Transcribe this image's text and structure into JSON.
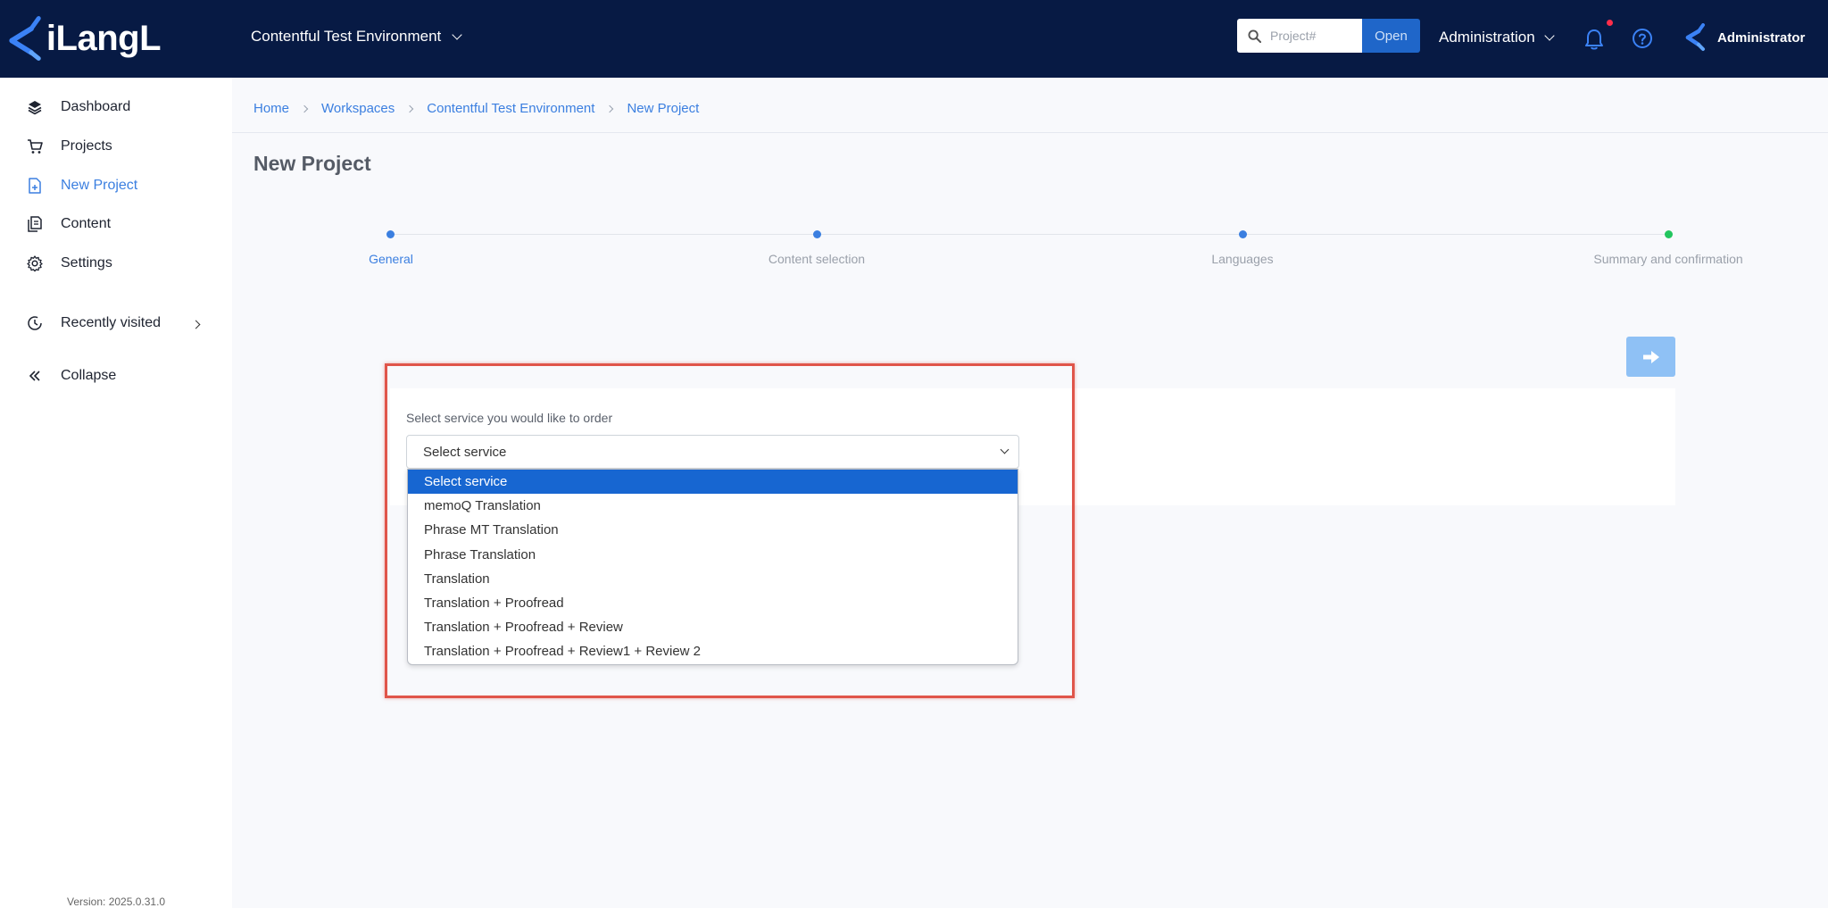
{
  "app": {
    "logo_text": "iLangL"
  },
  "header": {
    "workspace": "Contentful Test Environment",
    "search_placeholder": "Project#",
    "open_label": "Open",
    "admin_menu": "Administration",
    "user_name": "Administrator"
  },
  "sidebar": {
    "items": [
      {
        "label": "Dashboard"
      },
      {
        "label": "Projects"
      },
      {
        "label": "New Project"
      },
      {
        "label": "Content"
      },
      {
        "label": "Settings"
      },
      {
        "label": "Recently visited"
      },
      {
        "label": "Collapse"
      }
    ],
    "version": "Version: 2025.0.31.0"
  },
  "breadcrumb": [
    "Home",
    "Workspaces",
    "Contentful Test Environment",
    "New Project"
  ],
  "page_title": "New Project",
  "steps": [
    {
      "label": "General",
      "color": "#3b7fe0"
    },
    {
      "label": "Content selection",
      "color": "#3b7fe0"
    },
    {
      "label": "Languages",
      "color": "#3b7fe0"
    },
    {
      "label": "Summary and confirmation",
      "color": "#22c55e"
    }
  ],
  "form": {
    "service_label": "Select service you would like to order",
    "selected_value": "Select service",
    "options": [
      "Select service",
      "memoQ Translation",
      "Phrase MT Translation",
      "Phrase Translation",
      "Translation",
      "Translation + Proofread",
      "Translation + Proofread + Review",
      "Translation + Proofread + Review1 + Review 2"
    ]
  },
  "colors": {
    "topbar": "#071a44",
    "accent": "#3b7fe0",
    "highlight": "#e0554a"
  }
}
